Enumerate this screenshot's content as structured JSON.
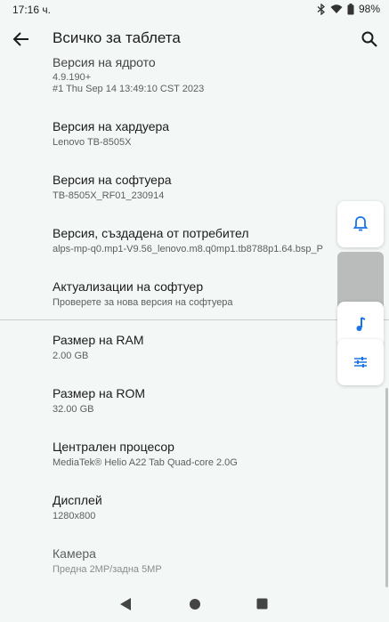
{
  "status_bar": {
    "time": "17:16 ч.",
    "battery": "98%",
    "icons": [
      "bluetooth-icon",
      "wifi-icon",
      "battery-icon"
    ]
  },
  "app_bar": {
    "title": "Всичко за таблета",
    "icons": [
      "back-arrow-icon",
      "search-icon"
    ]
  },
  "items": [
    {
      "title": "Версия на ядрото",
      "summary": [
        "4.9.190+",
        "#1 Thu Sep 14 13:49:10 CST 2023"
      ]
    },
    {
      "title": "Версия на хардуера",
      "summary": [
        "Lenovo TB-8505X"
      ]
    },
    {
      "title": "Версия на софтуера",
      "summary": [
        "TB-8505X_RF01_230914"
      ]
    },
    {
      "title": "Версия, създадена от потребител",
      "summary": [
        "alps-mp-q0.mp1-V9.56_lenovo.m8.q0mp1.tb8788p1.64.bsp_P"
      ]
    },
    {
      "title": "Актуализации на софтуер",
      "summary": [
        "Проверете за нова версия на софтуера"
      ]
    },
    {
      "title": "Размер на RAM",
      "summary": [
        "2.00 GB"
      ]
    },
    {
      "title": "Размер на ROM",
      "summary": [
        "32.00 GB"
      ]
    },
    {
      "title": "Централен процесор",
      "summary": [
        "MediaTek® Helio A22 Tab Quad-core 2.0G"
      ]
    },
    {
      "title": "Дисплей",
      "summary": [
        "1280x800"
      ]
    },
    {
      "title": "Камера",
      "summary": [
        "Предна 2MP/задна 5MP"
      ]
    }
  ],
  "side_panel": {
    "icons": [
      "bell-icon",
      "music-note-icon",
      "sliders-icon"
    ],
    "accent": "#1a73e8"
  },
  "nav_bar": {
    "icons": [
      "nav-back-icon",
      "nav-home-icon",
      "nav-recent-icon"
    ]
  }
}
